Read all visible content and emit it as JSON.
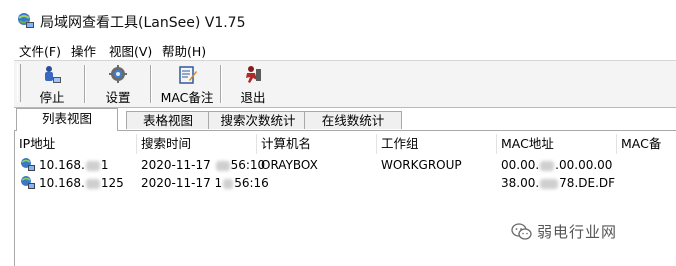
{
  "window": {
    "title": "局域网查看工具(LanSee) V1.75"
  },
  "menu": [
    "文件(F)",
    "操作",
    "视图(V)",
    "帮助(H)"
  ],
  "toolbar": {
    "stop": "停止",
    "settings": "设置",
    "mac_note": "MAC备注",
    "exit": "退出"
  },
  "tabs": [
    "列表视图",
    "表格视图",
    "搜索次数统计",
    "在线数统计"
  ],
  "table": {
    "columns": [
      "IP地址",
      "搜索时间",
      "计算机名",
      "工作组",
      "MAC地址",
      "MAC备"
    ],
    "rows": [
      {
        "ip_a": "10.168.",
        "ip_b": "1",
        "time_a": "2020-11-17 ",
        "time_b": "56:10",
        "computer": "ORAYBOX",
        "workgroup": "WORKGROUP",
        "mac_a": "00.00.",
        "mac_b": ".00.00.00"
      },
      {
        "ip_a": "10.168.",
        "ip_b": "125",
        "time_a": "2020-11-17 1",
        "time_b": "56:16",
        "computer": "",
        "workgroup": "",
        "mac_a": "38.00.",
        "mac_b": "78.DE.DF"
      }
    ]
  },
  "watermark": {
    "text": "弱电行业网"
  },
  "colors": {
    "toolbar_bg": "#f4f4f4",
    "tab_inactive_bg": "#f0f0f0",
    "border": "#a9a9a9"
  }
}
